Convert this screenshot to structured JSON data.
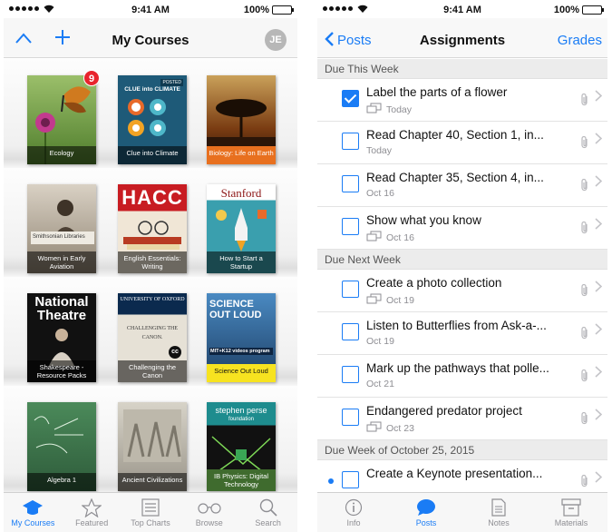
{
  "status": {
    "time": "9:41 AM",
    "battery": "100%"
  },
  "courses": {
    "title": "My Courses",
    "avatar": "JE",
    "books": [
      {
        "label": "Ecology",
        "badge": "9"
      },
      {
        "label": "Clue into Climate",
        "cover_text": "CLUE into CLIMATE",
        "cover_tag": "POSTED"
      },
      {
        "label": "Biology: Life on Earth"
      },
      {
        "label": "Women in Early Aviation",
        "cover_text": "Smithsonian Libraries"
      },
      {
        "label": "English Essentials: Writing",
        "cover_text": "HACC"
      },
      {
        "label": "How to Start a Startup",
        "cover_text": "Stanford"
      },
      {
        "label": "Shakespeare - Resource Packs",
        "cover_text": "National Theatre"
      },
      {
        "label": "Challenging the Canon",
        "cover_text": "UNIVERSITY OF OXFORD",
        "cover_text2": "CHALLENGING THE CANON."
      },
      {
        "label": "Science Out Loud",
        "cover_text": "SCIENCE OUT LOUD",
        "cover_text2": "MIT+K12 videos program"
      },
      {
        "label": "Algebra 1"
      },
      {
        "label": "Ancient Civilizations"
      },
      {
        "label": "IB Physics: Digital Technology",
        "cover_text": "stephen perse",
        "cover_text2": "foundation"
      }
    ],
    "tabs": [
      {
        "label": "My Courses",
        "icon": "graduation-cap-icon"
      },
      {
        "label": "Featured",
        "icon": "star-icon"
      },
      {
        "label": "Top Charts",
        "icon": "list-icon"
      },
      {
        "label": "Browse",
        "icon": "glasses-icon"
      },
      {
        "label": "Search",
        "icon": "search-icon"
      }
    ]
  },
  "assignments": {
    "back_label": "Posts",
    "title": "Assignments",
    "right_label": "Grades",
    "sections": [
      {
        "header": "Due This Week",
        "items": [
          {
            "title": "Label the parts of a flower",
            "date": "Today",
            "checked": true,
            "hand": true
          },
          {
            "title": "Read Chapter 40, Section 1, in...",
            "date": "Today",
            "checked": false,
            "hand": false
          },
          {
            "title": "Read Chapter 35, Section 4, in...",
            "date": "Oct 16",
            "checked": false,
            "hand": false
          },
          {
            "title": "Show what you know",
            "date": "Oct 16",
            "checked": false,
            "hand": true
          }
        ]
      },
      {
        "header": "Due Next Week",
        "items": [
          {
            "title": "Create a photo collection",
            "date": "Oct 19",
            "checked": false,
            "hand": true
          },
          {
            "title": "Listen to Butterflies from Ask-a-...",
            "date": "Oct 19",
            "checked": false,
            "hand": false
          },
          {
            "title": "Mark up the pathways that polle...",
            "date": "Oct 21",
            "checked": false,
            "hand": false
          },
          {
            "title": "Endangered predator project",
            "date": "Oct 23",
            "checked": false,
            "hand": true
          }
        ]
      },
      {
        "header": "Due Week of October 25, 2015",
        "items": [
          {
            "title": "Create a Keynote presentation...",
            "date": "",
            "checked": false,
            "hand": false,
            "unread": true
          }
        ]
      }
    ],
    "tabs": [
      {
        "label": "Info",
        "icon": "info-icon"
      },
      {
        "label": "Posts",
        "icon": "speech-bubble-icon",
        "active": true
      },
      {
        "label": "Notes",
        "icon": "notes-icon"
      },
      {
        "label": "Materials",
        "icon": "box-icon"
      }
    ]
  },
  "colors": {
    "accent": "#1a7cf5",
    "badge": "#e8242d"
  }
}
